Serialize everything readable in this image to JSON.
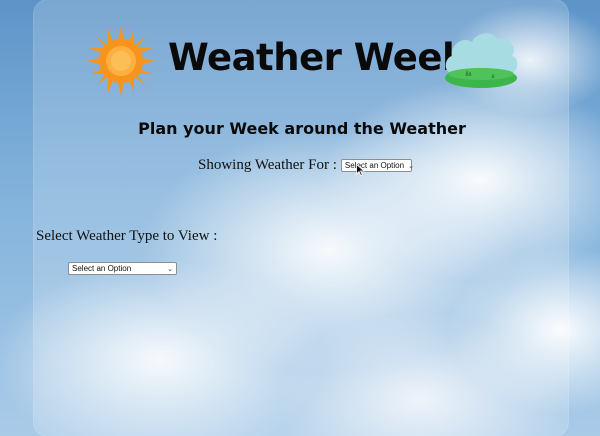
{
  "header": {
    "title": "Weather Week",
    "sun_icon": "sun-icon",
    "cloud_icon": "cloud-with-grass-icon"
  },
  "subtitle": "Plan your Week around the Weather",
  "location": {
    "label": "Showing Weather For :",
    "select_value": "Select an Option"
  },
  "weather_type": {
    "label": "Select Weather Type to View :",
    "select_value": "Select an Option"
  },
  "colors": {
    "sun": "#f7941d",
    "sun_center": "#fbb040",
    "cloud": "#a8dce3",
    "grass": "#3cb54a",
    "title_text": "#0a0a0a"
  }
}
